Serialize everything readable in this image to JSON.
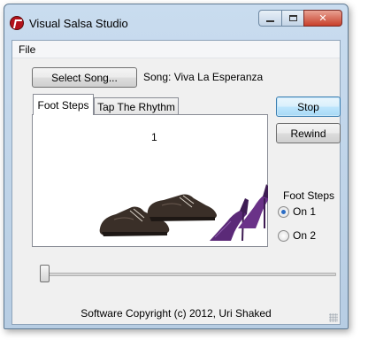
{
  "window": {
    "title": "Visual Salsa Studio"
  },
  "menu": {
    "file": "File"
  },
  "song": {
    "select_button": "Select Song...",
    "label": "Song: Viva La Esperanza"
  },
  "controls": {
    "stop": "Stop",
    "rewind": "Rewind"
  },
  "tabs": [
    {
      "label": "Foot Steps",
      "selected": true
    },
    {
      "label": "Tap The Rhythm",
      "selected": false
    }
  ],
  "beat_counter": "1",
  "foot_steps_group": {
    "title": "Foot Steps",
    "options": [
      {
        "label": "On 1",
        "checked": true
      },
      {
        "label": "On 2",
        "checked": false
      }
    ]
  },
  "position_slider": {
    "value": 0
  },
  "footer": {
    "copyright": "Software Copyright (c) 2012, Uri Shaked"
  },
  "colors": {
    "stop_button": "#bee6fd",
    "close_button": "#c8402b",
    "heels": "#5b2a78",
    "men_shoes": "#3a2f28"
  }
}
